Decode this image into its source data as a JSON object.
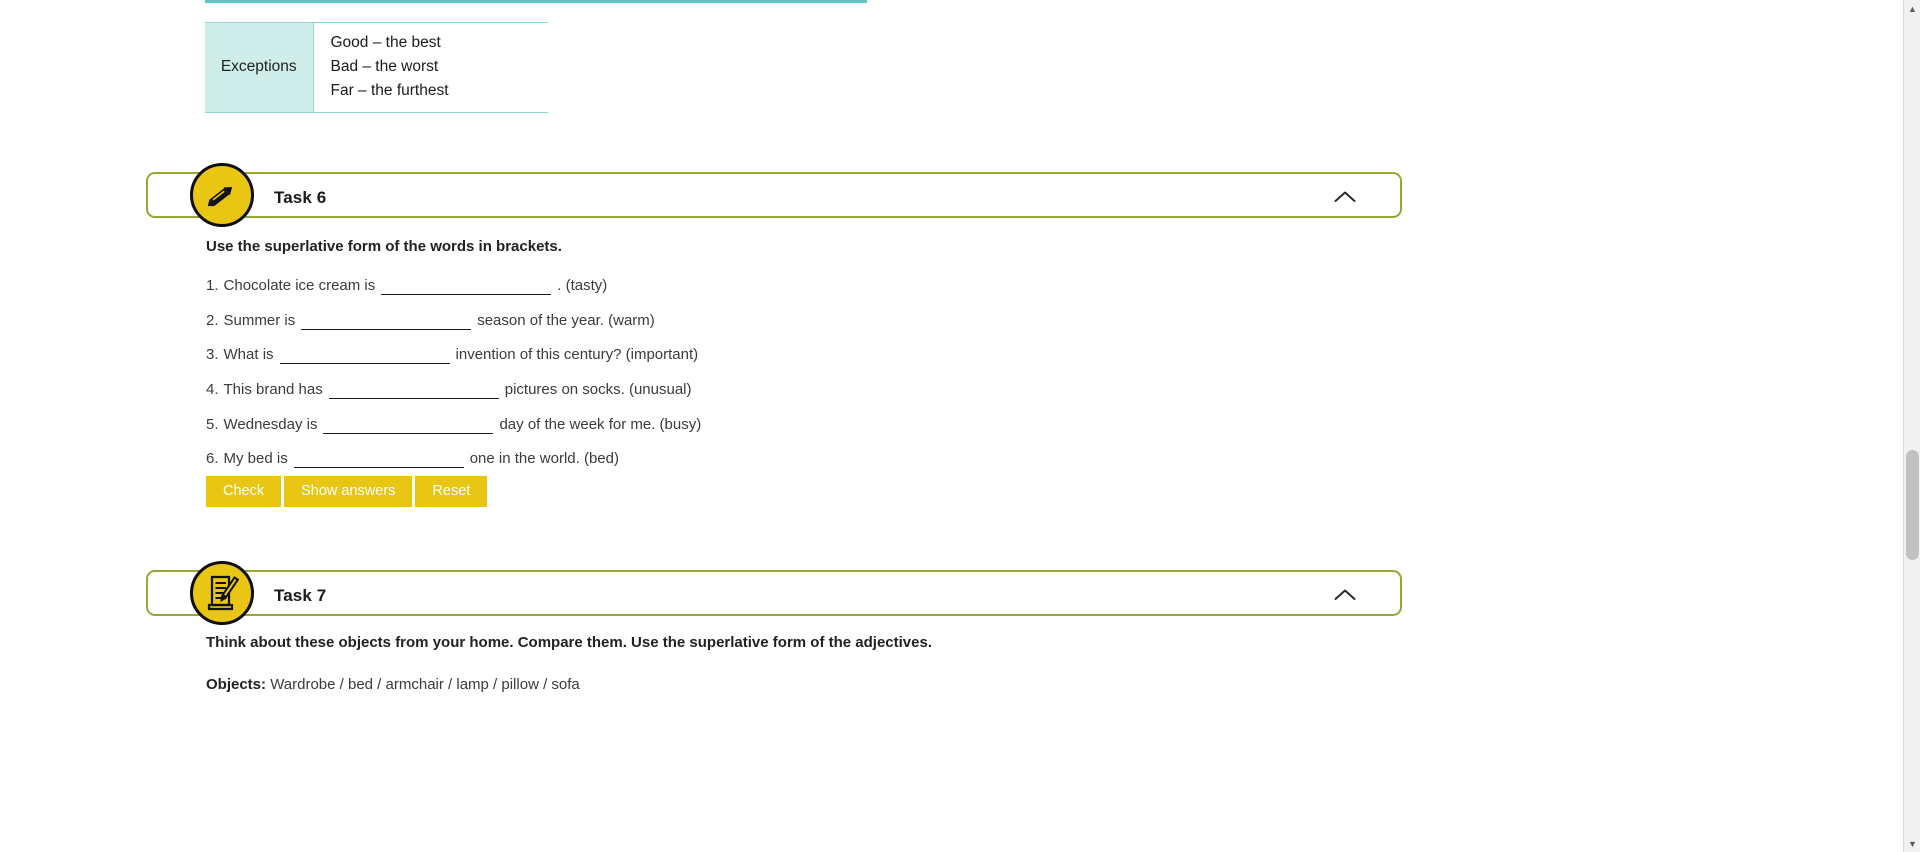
{
  "exceptions_table": {
    "label": "Exceptions",
    "items": [
      "Good – the best",
      "Bad – the worst",
      "Far – the furthest"
    ]
  },
  "task6": {
    "title": "Task 6",
    "icon": "pencil-icon",
    "collapse_icon": "chevron-up-icon",
    "instruction": "Use the superlative form of the words in brackets.",
    "questions": [
      {
        "num": "1.",
        "before": "Chocolate ice cream is",
        "after": ". (tasty)",
        "blank_value": "",
        "blank_width": 170
      },
      {
        "num": "2.",
        "before": "Summer is",
        "after": "season of the year. (warm)",
        "blank_value": "",
        "blank_width": 170
      },
      {
        "num": "3.",
        "before": "What is",
        "after": "invention of this century? (important)",
        "blank_value": "",
        "blank_width": 170
      },
      {
        "num": "4.",
        "before": "This brand has",
        "after": "pictures on socks. (unusual)",
        "blank_value": "",
        "blank_width": 170
      },
      {
        "num": "5.",
        "before": "Wednesday is",
        "after": "day of the week for me. (busy)",
        "blank_value": "",
        "blank_width": 170
      },
      {
        "num": "6.",
        "before": "My bed is",
        "after": "one in the world. (bed)",
        "blank_value": "",
        "blank_width": 170
      }
    ],
    "buttons": {
      "check": "Check",
      "show_answers": "Show answers",
      "reset": "Reset"
    }
  },
  "task7": {
    "title": "Task 7",
    "icon": "document-pencil-icon",
    "collapse_icon": "chevron-up-icon",
    "instruction": "Think about these objects from your home. Compare them. Use the superlative form of the adjectives.",
    "objects_label": "Objects:",
    "objects_value": "Wardrobe / bed / armchair / lamp / pillow / sofa"
  },
  "colors": {
    "accent_green": "#96a736",
    "accent_yellow": "#e8c613",
    "teal_border": "#8ed8d2",
    "teal_fill": "#cfeeea",
    "teal_rule": "#5ec8c0"
  },
  "scrollbar": {
    "up_arrow": "▲",
    "down_arrow": "▼"
  }
}
